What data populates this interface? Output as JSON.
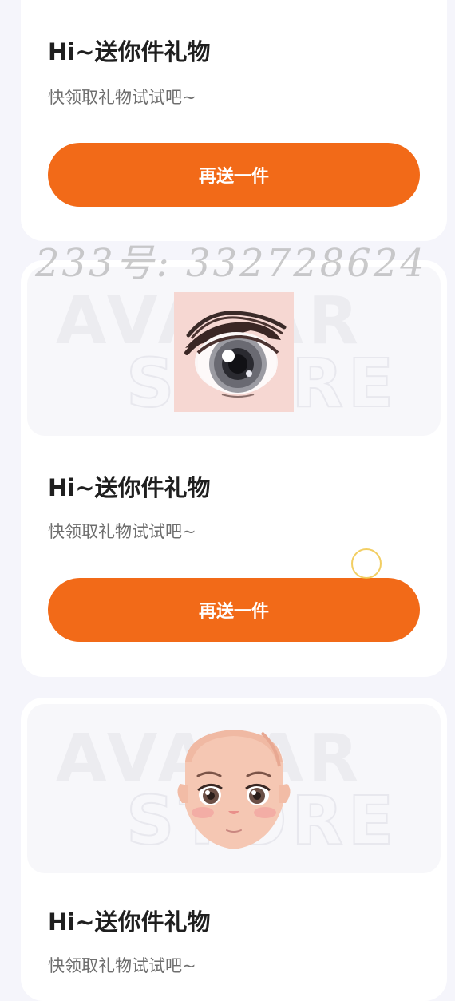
{
  "cards": [
    {
      "title": "Hi~送你件礼物",
      "subtitle": "快领取礼物试试吧~",
      "button_label": "再送一件"
    },
    {
      "watermark_line1": "AVATAR",
      "watermark_line2": "STORE",
      "image": "anime-eye-image",
      "title": "Hi~送你件礼物",
      "subtitle": "快领取礼物试试吧~",
      "button_label": "再送一件"
    },
    {
      "watermark_line1": "AVATAR",
      "watermark_line2": "STORE",
      "image": "anime-face-image",
      "title": "Hi~送你件礼物",
      "subtitle": "快领取礼物试试吧~"
    }
  ],
  "overlay_watermark": "233号: 332728624",
  "colors": {
    "accent": "#f26a18",
    "page_background": "#f5f5fb",
    "card_background": "#ffffff"
  }
}
